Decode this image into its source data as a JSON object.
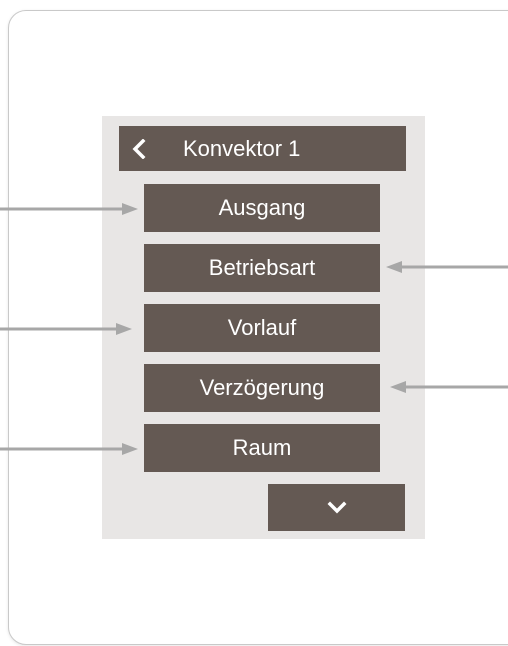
{
  "header": {
    "title": "Konvektor 1"
  },
  "icons": {
    "back": "chevron-left-icon",
    "down": "chevron-down-icon"
  },
  "menu": {
    "items": [
      {
        "label": "Ausgang"
      },
      {
        "label": "Betriebsart"
      },
      {
        "label": "Vorlauf"
      },
      {
        "label": "Verzögerung"
      },
      {
        "label": "Raum"
      }
    ]
  },
  "colors": {
    "button_bg": "#645953",
    "panel_bg": "#e8e6e5",
    "text": "#ffffff",
    "pointer_arrow": "#a7a7a7"
  }
}
